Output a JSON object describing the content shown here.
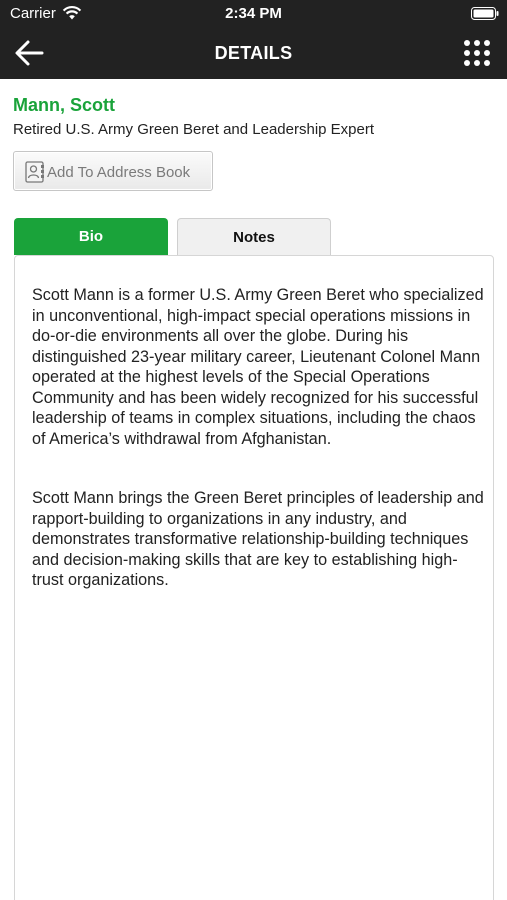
{
  "status": {
    "carrier": "Carrier",
    "time": "2:34 PM"
  },
  "nav": {
    "title": "DETAILS",
    "back_icon": "back-arrow-icon",
    "menu_icon": "grid-menu-icon"
  },
  "contact": {
    "name": "Mann, Scott",
    "subtitle": "Retired U.S. Army Green Beret and Leadership Expert",
    "address_book_label": "Add To Address Book"
  },
  "tabs": [
    {
      "label": "Bio",
      "active": true
    },
    {
      "label": "Notes",
      "active": false
    }
  ],
  "bio": {
    "paragraph_1": "Scott Mann is a former U.S. Army Green Beret who specialized in unconventional, high-impact special operations missions in do-or-die environments all over the globe. During his distinguished 23-year military career, Lieutenant Colonel Mann operated at the highest levels of the Special Operations Community and has been widely recognized for his successful leadership of teams in complex situations, including the chaos of America’s withdrawal from Afghanistan.",
    "paragraph_2": "Scott Mann brings the Green Beret principles of leadership and rapport-building to organizations in any industry, and demonstrates transformative relationship-building techniques and decision-making skills that are key to establishing high-trust organizations."
  },
  "colors": {
    "accent": "#1aa33a",
    "header": "#222222"
  }
}
